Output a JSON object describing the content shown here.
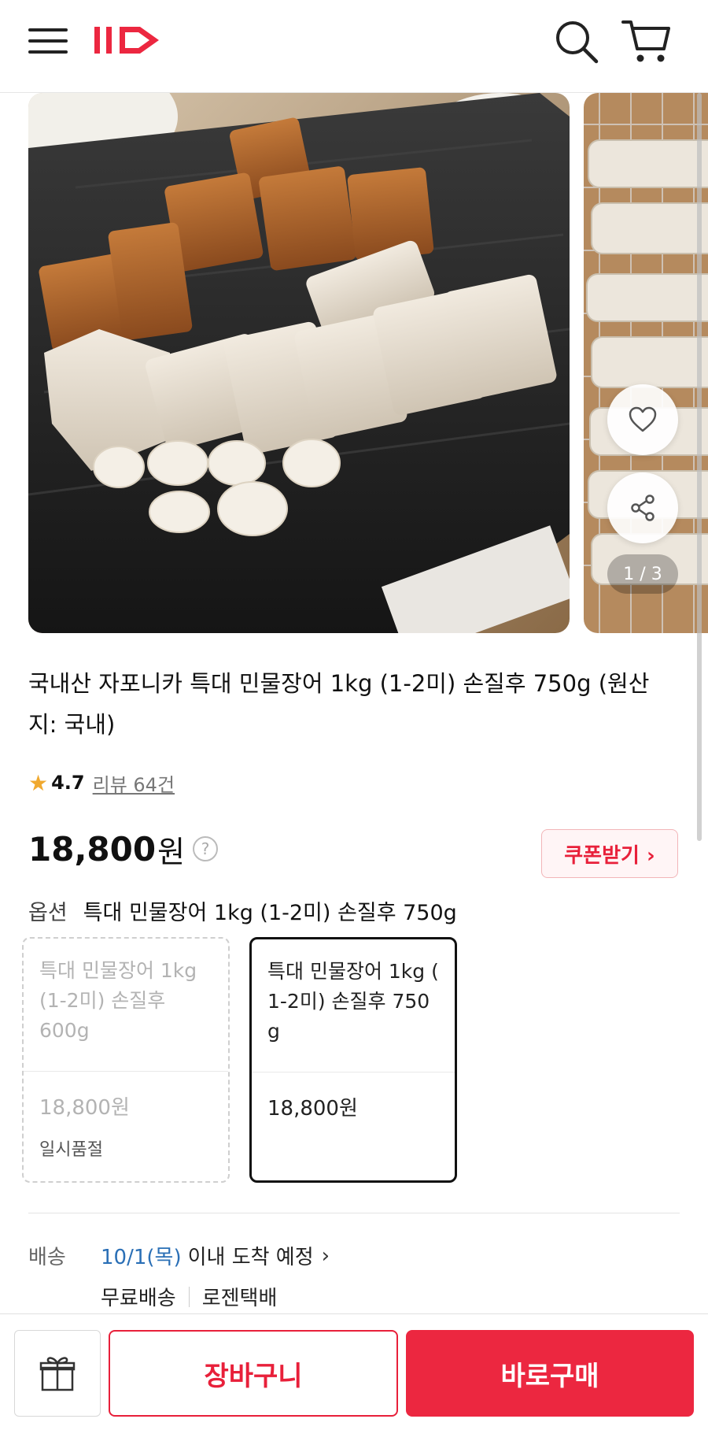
{
  "header": {
    "logo_text": "11",
    "menu_icon": "hamburger-icon",
    "search_icon": "search-icon",
    "cart_icon": "cart-icon"
  },
  "gallery": {
    "pager": "1 / 3",
    "wishlist_icon": "heart-icon",
    "share_icon": "share-icon"
  },
  "product": {
    "title": "국내산 자포니카 특대 민물장어 1kg (1-2미) 손질후 750g (원산지: 국내)",
    "rating": "4.7",
    "review": "리뷰 64건",
    "price": "18,800",
    "currency": "원",
    "help": "?",
    "coupon_label": "쿠폰받기 ›"
  },
  "option": {
    "label": "옵션",
    "selected": "특대 민물장어 1kg (1-2미) 손질후 750g",
    "cards": [
      {
        "name": "특대 민물장어 1kg (1-2미) 손질후 600g",
        "price": "18,800원",
        "status": "일시품절"
      },
      {
        "name": "특대 민물장어 1kg ( 1-2미) 손질후 750 g",
        "price": "18,800원",
        "status": ""
      }
    ]
  },
  "shipping": {
    "label": "배송",
    "date": "10/1(목)",
    "arrival": "이내 도착 예정",
    "chevron": "›",
    "fee": "무료배송",
    "carrier": "로젠택배"
  },
  "bottom": {
    "gift_icon": "gift-icon",
    "cart_label": "장바구니",
    "buy_label": "바로구매"
  },
  "colors": {
    "accent": "#ec2740",
    "link_blue": "#2a6fb6",
    "star": "#f0a92f"
  }
}
